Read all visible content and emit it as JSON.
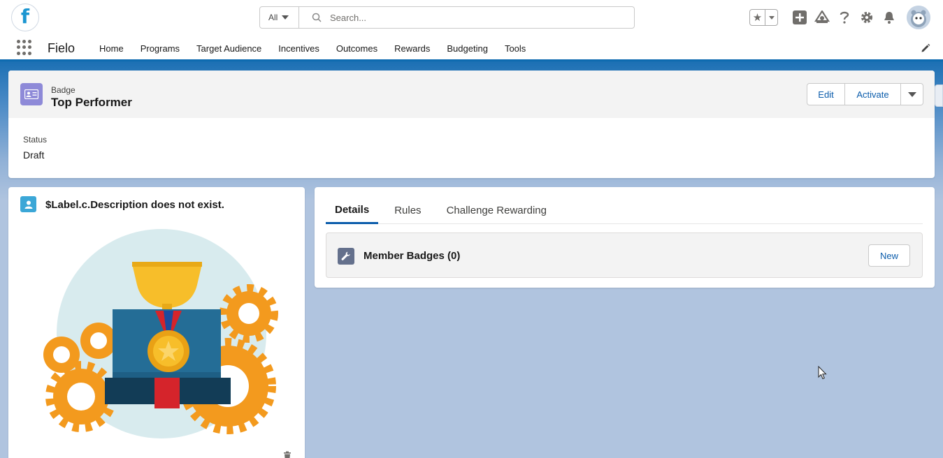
{
  "global_header": {
    "logo_letter": "f",
    "search": {
      "scope": "All",
      "placeholder": "Search..."
    },
    "tools": [
      "favorites-icon",
      "add-icon",
      "trailhead-icon",
      "help-icon",
      "setup-gear-icon",
      "notifications-bell-icon",
      "user-avatar"
    ]
  },
  "nav": {
    "app_name": "Fielo",
    "items": [
      "Home",
      "Programs",
      "Target Audience",
      "Incentives",
      "Outcomes",
      "Rewards",
      "Budgeting",
      "Tools"
    ]
  },
  "record": {
    "object_type": "Badge",
    "name": "Top Performer",
    "actions": {
      "edit": "Edit",
      "activate": "Activate"
    },
    "fields": [
      {
        "label": "Status",
        "value": "Draft"
      }
    ]
  },
  "left_card": {
    "title": "$Label.c.Description does not exist."
  },
  "right_card": {
    "tabs": [
      "Details",
      "Rules",
      "Challenge Rewarding"
    ],
    "active_tab": "Details",
    "related_list": {
      "title": "Member Badges (0)",
      "new_label": "New"
    }
  },
  "colors": {
    "brand_blue": "#0b5cab",
    "badge_icon": "#8e8ad8",
    "background": "#b0c4df"
  }
}
